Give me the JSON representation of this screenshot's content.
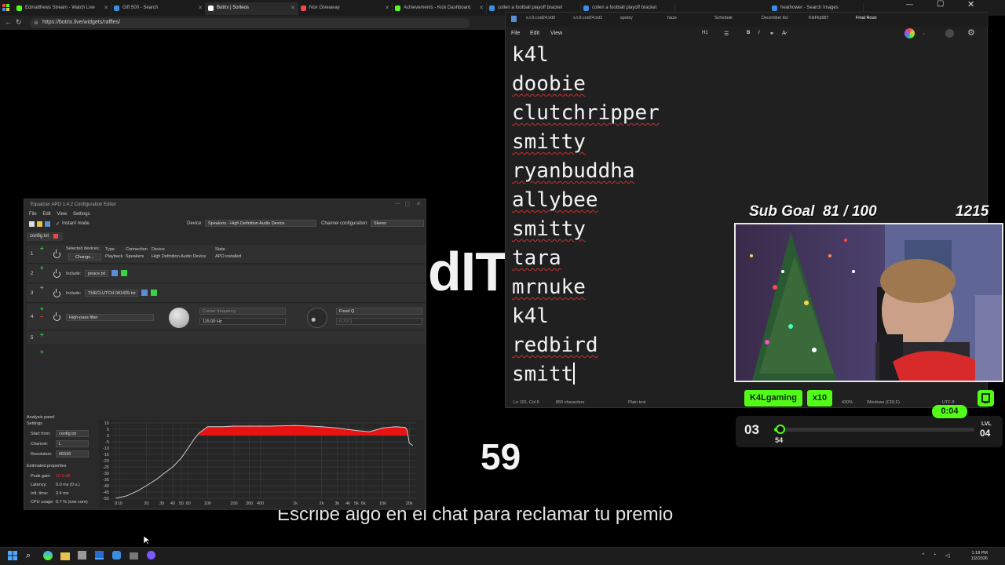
{
  "browser": {
    "tabs": [
      {
        "label": "Edmatthews Stream - Watch Live",
        "color": "#53fc18",
        "active": false
      },
      {
        "label": "Gift 500 - Search",
        "color": "#3a8ee6",
        "active": false
      },
      {
        "label": "Botrix | Sorteos",
        "color": "#ffffff",
        "active": true
      },
      {
        "label": "Nov Giveaway",
        "color": "#e84a4a",
        "active": false
      },
      {
        "label": "Achievements - Kick Dashboard",
        "color": "#53fc18",
        "active": false
      },
      {
        "label": "collen a football playoff bracket",
        "color": "#3a8ee6",
        "active": false
      },
      {
        "label": "collen a football playoff bracket",
        "color": "#3a8ee6",
        "active": false
      },
      {
        "label": "heathower - Search Images",
        "color": "#3a8ee6",
        "active": false
      }
    ],
    "url": "https://botrix.live/widgets/raffles/"
  },
  "background": {
    "fragment": "dIT",
    "countdown": "59",
    "caption": "Escribe algo en el chat para reclamar tu premio"
  },
  "equalizer": {
    "title": "Equalizer APO 1.4.2 Configuration Editor",
    "menu": [
      "File",
      "Edit",
      "View",
      "Settings"
    ],
    "instant_mode": "Instant mode",
    "device_label": "Device:",
    "device_value": "Speakers - High Definition Audio Device",
    "channel_label": "Channel configuration:",
    "channel_value": "Stereo",
    "config_tab": "config.txt",
    "row1": {
      "num": "1",
      "selected_devices": "Selected devices:",
      "change": "Change...",
      "headers": [
        "Type",
        "Connection",
        "Device",
        "State"
      ],
      "values": [
        "Playback",
        "Speakers",
        "High Definition Audio Device",
        "APO installed"
      ]
    },
    "row2": {
      "num": "2",
      "include": "Include:",
      "file": "peace.txt"
    },
    "row3": {
      "num": "3",
      "include": "Include:",
      "file": "THECLUTCH 041425.txt"
    },
    "row4": {
      "num": "4",
      "filter": "High-pass filter",
      "corner_label": "Corner frequency",
      "corner_value": "115.00 Hz",
      "q_label": "Fixed Q",
      "q_value": "0.7071"
    },
    "row5": {
      "num": "5"
    },
    "analysis": {
      "title": "Analysis panel",
      "settings": "Settings",
      "start_from_label": "Start from:",
      "start_from_value": "config.txt",
      "channel_label": "Channel:",
      "channel_value": "L",
      "resolution_label": "Resolution:",
      "resolution_value": "65536",
      "estimated": "Estimated properties",
      "peak_gain_label": "Peak gain:",
      "peak_gain_value": "10.0 dB",
      "latency_label": "Latency:",
      "latency_value": "0.0 ms (0 s.)",
      "init_label": "Init. time:",
      "init_value": "3.4 ms",
      "cpu_label": "CPU usage:",
      "cpu_value": "0.7 % (one core)"
    }
  },
  "chart_data": {
    "type": "line",
    "x_ticks": [
      "9",
      "10",
      "20",
      "30",
      "40",
      "50",
      "60",
      "100",
      "200",
      "300",
      "400",
      "1k",
      "2k",
      "3k",
      "4k",
      "5k",
      "6k",
      "10k",
      "20k"
    ],
    "y_ticks": [
      "10",
      "5",
      "0",
      "-5",
      "-10",
      "-15",
      "-20",
      "-25",
      "-30",
      "-35",
      "-40",
      "-45",
      "-50"
    ],
    "ylim": [
      -50,
      10
    ],
    "fill_color": "#e81212",
    "curve_color": "#cfcfcf",
    "x": [
      9,
      12,
      16,
      20,
      26,
      32,
      40,
      50,
      60,
      70,
      80,
      100,
      150,
      200,
      300,
      500,
      1000,
      1500,
      2000,
      3000,
      5000,
      7000,
      10000,
      14000,
      18000,
      19000,
      20000,
      22000
    ],
    "y": [
      -50,
      -48,
      -44,
      -40,
      -35,
      -30,
      -25,
      -18,
      -10,
      -3,
      2,
      7,
      7,
      7.5,
      7.5,
      7.5,
      8,
      7.5,
      7,
      6,
      4,
      3,
      6,
      7,
      6.5,
      4,
      -6,
      -8
    ]
  },
  "notepad": {
    "tabs": [
      "s.t.0.cod24.txt0",
      "s.t.0.cod24.txt1",
      "spotsy",
      "haze",
      "Schedule",
      "December ticl",
      "KikFlip987",
      "Final Roun"
    ],
    "menu": [
      "File",
      "Edit",
      "View"
    ],
    "toolbar": [
      "H1",
      "B",
      "I"
    ],
    "lines": [
      "k4l",
      "doobie",
      "clutchripper",
      "smitty",
      "ryanbuddha",
      "allybee",
      "smitty",
      "tara",
      "mrnuke",
      "k4l",
      "redbird",
      "smitt"
    ],
    "status": {
      "position": "Ln 101, Col 6",
      "chars": "859 characters",
      "format": "Plain text",
      "zoom": "430%",
      "eol": "Windows (CRLF)",
      "encoding": "UTF-8"
    }
  },
  "stream": {
    "sub_goal_label": "Sub Goal",
    "sub_goal_value": "81 / 100",
    "sub_count": "1215",
    "username": "K4Lgaming",
    "multiplier": "x10",
    "timer": "0:04",
    "level_current": "03",
    "level_next_label": "LVL",
    "level_next": "04",
    "xp": "54",
    "xp_fraction": 0.02,
    "accent": "#53fc18"
  },
  "taskbar": {
    "time": "1:18 PM",
    "date": "1/2/2026"
  }
}
